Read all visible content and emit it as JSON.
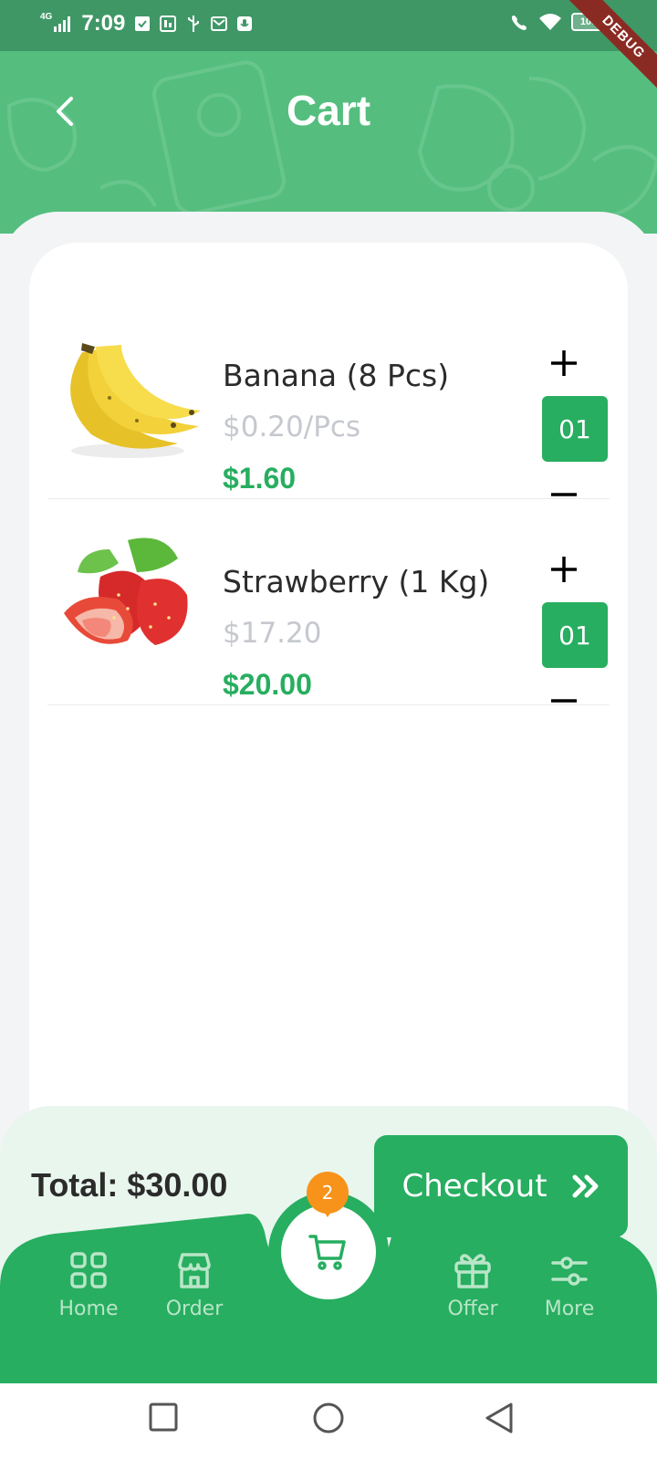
{
  "status_bar": {
    "network": "4G",
    "time": "7:09",
    "battery": "100",
    "debug_banner": "DEBUG"
  },
  "header": {
    "title": "Cart",
    "back_icon": "chevron-left-icon"
  },
  "cart": {
    "items": [
      {
        "name": "Banana (8 Pcs)",
        "unit_price": "$0.20/Pcs",
        "total_price": "$1.60",
        "quantity": "01",
        "image": "banana-image"
      },
      {
        "name": "Strawberry (1 Kg)",
        "unit_price": "$17.20",
        "total_price": "$20.00",
        "quantity": "01",
        "image": "strawberry-image"
      }
    ]
  },
  "footer": {
    "total": "Total: $30.00",
    "checkout_label": "Checkout",
    "checkout_icon": "double-chevron-right-icon"
  },
  "bottom_nav": {
    "items": [
      {
        "label": "Home",
        "icon": "grid-icon"
      },
      {
        "label": "Order",
        "icon": "store-icon"
      },
      {
        "label": "Offer",
        "icon": "gift-icon"
      },
      {
        "label": "More",
        "icon": "sliders-icon"
      }
    ],
    "cart_badge": "2",
    "cart_icon": "cart-icon"
  },
  "colors": {
    "brand_green": "#27ae60",
    "header_green": "#55be7f",
    "status_green": "#3f9766",
    "badge_orange": "#f7931a",
    "muted_text": "#c5c8ce"
  }
}
